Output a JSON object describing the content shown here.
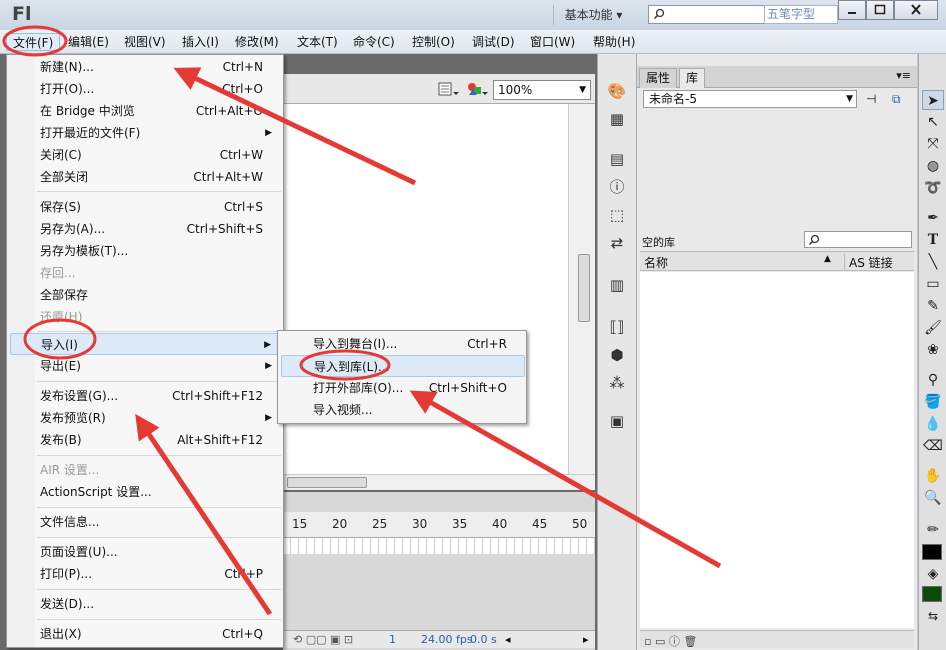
{
  "app": {
    "logo": "Fl",
    "workspace": "基本功能",
    "watermark": "五笔字型"
  },
  "menubar": [
    "文件(F)",
    "编辑(E)",
    "视图(V)",
    "插入(I)",
    "修改(M)",
    "文本(T)",
    "命令(C)",
    "控制(O)",
    "调试(D)",
    "窗口(W)",
    "帮助(H)"
  ],
  "stage": {
    "zoom": "100%"
  },
  "timeline": {
    "ruler": [
      "15",
      "20",
      "25",
      "30",
      "35",
      "40",
      "45",
      "50"
    ],
    "frame": "1",
    "fps": "24.00 fps",
    "time": "0.0 s"
  },
  "library": {
    "tab_properties": "属性",
    "tab_library": "库",
    "document": "未命名-5",
    "empty_label": "空的库",
    "col_name": "名称",
    "col_linkage": "AS 链接"
  },
  "file_menu": {
    "items": [
      {
        "label": "新建(N)...",
        "shortcut": "Ctrl+N"
      },
      {
        "label": "打开(O)...",
        "shortcut": "Ctrl+O"
      },
      {
        "label": "在 Bridge 中浏览",
        "shortcut": "Ctrl+Alt+O"
      },
      {
        "label": "打开最近的文件(F)",
        "shortcut": ""
      },
      {
        "label": "关闭(C)",
        "shortcut": "Ctrl+W"
      },
      {
        "label": "全部关闭",
        "shortcut": "Ctrl+Alt+W"
      },
      {
        "label": "保存(S)",
        "shortcut": "Ctrl+S"
      },
      {
        "label": "另存为(A)...",
        "shortcut": "Ctrl+Shift+S"
      },
      {
        "label": "另存为模板(T)...",
        "shortcut": ""
      },
      {
        "label": "存回...",
        "shortcut": ""
      },
      {
        "label": "全部保存",
        "shortcut": ""
      },
      {
        "label": "还原(H)",
        "shortcut": ""
      },
      {
        "label": "导入(I)",
        "shortcut": ""
      },
      {
        "label": "导出(E)",
        "shortcut": ""
      },
      {
        "label": "发布设置(G)...",
        "shortcut": "Ctrl+Shift+F12"
      },
      {
        "label": "发布预览(R)",
        "shortcut": ""
      },
      {
        "label": "发布(B)",
        "shortcut": "Alt+Shift+F12"
      },
      {
        "label": "AIR 设置...",
        "shortcut": ""
      },
      {
        "label": "ActionScript 设置...",
        "shortcut": ""
      },
      {
        "label": "文件信息...",
        "shortcut": ""
      },
      {
        "label": "页面设置(U)...",
        "shortcut": ""
      },
      {
        "label": "打印(P)...",
        "shortcut": "Ctrl+P"
      },
      {
        "label": "发送(D)...",
        "shortcut": ""
      },
      {
        "label": "退出(X)",
        "shortcut": "Ctrl+Q"
      }
    ]
  },
  "import_submenu": {
    "items": [
      {
        "label": "导入到舞台(I)...",
        "shortcut": "Ctrl+R"
      },
      {
        "label": "导入到库(L)...",
        "shortcut": ""
      },
      {
        "label": "打开外部库(O)...",
        "shortcut": "Ctrl+Shift+O"
      },
      {
        "label": "导入视频...",
        "shortcut": ""
      }
    ]
  },
  "colors": {
    "annotation": "#e53935",
    "highlight": "#dce9f7",
    "stroke_swatch": "#000000",
    "fill_swatch": "#0a4a0a"
  }
}
